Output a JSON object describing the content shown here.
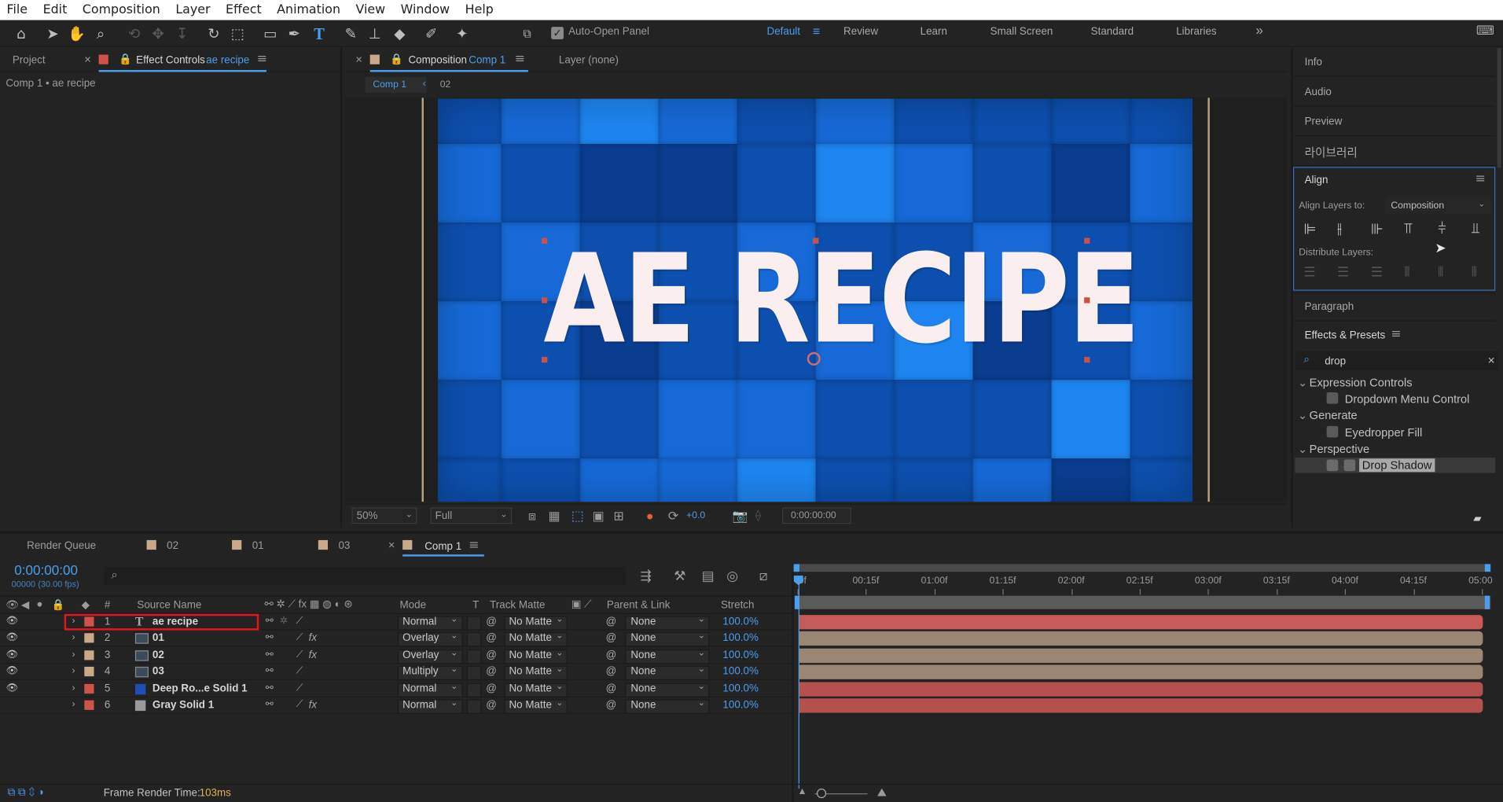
{
  "menu": [
    "File",
    "Edit",
    "Composition",
    "Layer",
    "Effect",
    "Animation",
    "View",
    "Window",
    "Help"
  ],
  "toolbar": {
    "auto_open_panel": "Auto-Open Panel",
    "workspaces": [
      "Default",
      "Review",
      "Learn",
      "Small Screen",
      "Standard",
      "Libraries"
    ],
    "active_workspace": "Default",
    "more": "»"
  },
  "left_panel": {
    "tab_project": "Project",
    "tab_effect_controls": "Effect Controls",
    "effect_layer": "ae recipe",
    "breadcrumb": "Comp 1 • ae recipe"
  },
  "comp_panel": {
    "tab_composition": "Composition",
    "comp_name": "Comp 1",
    "layer_tab": "Layer (none)",
    "flow_current": "Comp 1",
    "flow_prev": "02",
    "zoom": "50%",
    "resolution": "Full",
    "exposure": "+0.0",
    "timecode": "0:00:00:00",
    "title_text": "AE RECIPE",
    "grid_colors": [
      "#0d4fae",
      "#1669d6",
      "#1e85f0",
      "#0a3d8f"
    ]
  },
  "right_panel": {
    "info": "Info",
    "audio": "Audio",
    "preview": "Preview",
    "libraries_kr": "라이브러리",
    "align": {
      "title": "Align",
      "align_to_label": "Align Layers to:",
      "align_to_value": "Composition",
      "distribute_label": "Distribute Layers:"
    },
    "paragraph": "Paragraph",
    "effects_presets": {
      "title": "Effects & Presets",
      "search": "drop",
      "tree": [
        {
          "group": "Expression Controls",
          "items": [
            "Dropdown Menu Control"
          ]
        },
        {
          "group": "Generate",
          "items": [
            "Eyedropper Fill"
          ]
        },
        {
          "group": "Perspective",
          "items": [
            "Drop Shadow"
          ]
        }
      ]
    }
  },
  "timeline": {
    "tabs": [
      "Render Queue",
      "02",
      "01",
      "03",
      "Comp 1"
    ],
    "active_tab": "Comp 1",
    "current_time": "0:00:00:00",
    "frame_info": "00000 (30.00 fps)",
    "columns": {
      "num": "#",
      "source": "Source Name",
      "mode": "Mode",
      "t": "T",
      "track_matte": "Track Matte",
      "parent": "Parent & Link",
      "stretch": "Stretch"
    },
    "layers": [
      {
        "num": "1",
        "name": "ae recipe",
        "type": "text",
        "label": "#d1524a",
        "mode": "Normal",
        "matte": "No Matte",
        "parent": "None",
        "stretch": "100.0%",
        "fx": false,
        "bar": "#c65a56",
        "visible": true
      },
      {
        "num": "2",
        "name": "01",
        "type": "footage",
        "label": "#c8a98a",
        "mode": "Overlay",
        "matte": "No Matte",
        "parent": "None",
        "stretch": "100.0%",
        "fx": true,
        "bar": "#9a8672",
        "visible": true
      },
      {
        "num": "3",
        "name": "02",
        "type": "footage",
        "label": "#c8a98a",
        "mode": "Overlay",
        "matte": "No Matte",
        "parent": "None",
        "stretch": "100.0%",
        "fx": true,
        "bar": "#9a8672",
        "visible": true
      },
      {
        "num": "4",
        "name": "03",
        "type": "footage",
        "label": "#c8a98a",
        "mode": "Multiply",
        "matte": "No Matte",
        "parent": "None",
        "stretch": "100.0%",
        "fx": false,
        "bar": "#9a8672",
        "visible": true
      },
      {
        "num": "5",
        "name": "Deep Ro...e Solid 1",
        "type": "solid",
        "label": "#d1524a",
        "swatch": "#1f4fb5",
        "mode": "Normal",
        "matte": "No Matte",
        "parent": "None",
        "stretch": "100.0%",
        "fx": false,
        "bar": "#b5504e",
        "visible": true
      },
      {
        "num": "6",
        "name": "Gray Solid 1",
        "type": "solid",
        "label": "#d1524a",
        "swatch": "#9a9a9a",
        "mode": "Normal",
        "matte": "No Matte",
        "parent": "None",
        "stretch": "100.0%",
        "fx": true,
        "bar": "#b5504e",
        "visible": false
      }
    ],
    "ruler": [
      "0f",
      "00:15f",
      "01:00f",
      "01:15f",
      "02:00f",
      "02:15f",
      "03:00f",
      "03:15f",
      "04:00f",
      "04:15f",
      "05:00"
    ],
    "footer_label": "Frame Render Time:",
    "footer_value": "103ms"
  },
  "colors": {
    "accent": "#4a9ef0",
    "panel": "#232323",
    "selection": "#e8161c"
  }
}
